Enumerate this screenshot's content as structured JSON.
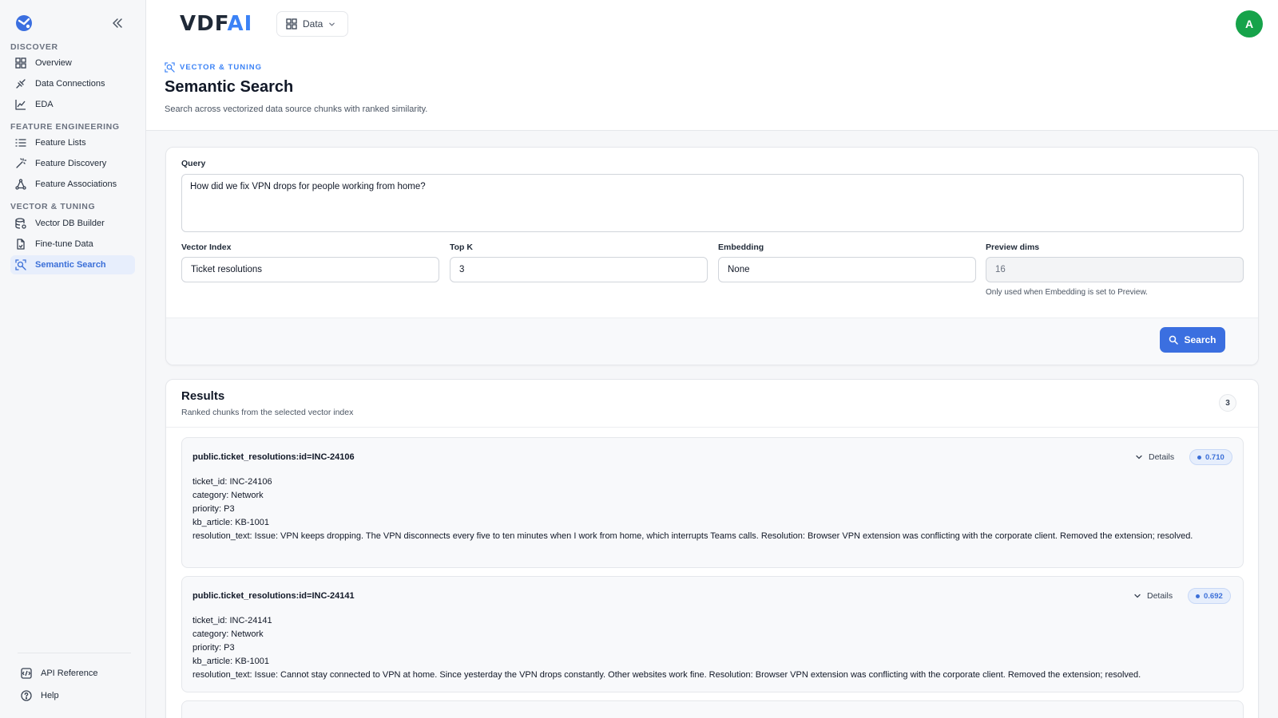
{
  "sidebar": {
    "sections": [
      {
        "title": "DISCOVER",
        "items": [
          {
            "label": "Overview",
            "icon": "grid-icon"
          },
          {
            "label": "Data Connections",
            "icon": "plug-icon"
          },
          {
            "label": "EDA",
            "icon": "chart-icon"
          }
        ]
      },
      {
        "title": "FEATURE ENGINEERING",
        "items": [
          {
            "label": "Feature Lists",
            "icon": "list-icon"
          },
          {
            "label": "Feature Discovery",
            "icon": "wand-icon"
          },
          {
            "label": "Feature Associations",
            "icon": "network-icon"
          }
        ]
      },
      {
        "title": "VECTOR & TUNING",
        "items": [
          {
            "label": "Vector DB Builder",
            "icon": "database-icon"
          },
          {
            "label": "Fine-tune Data",
            "icon": "file-icon"
          },
          {
            "label": "Semantic Search",
            "icon": "search-scan-icon",
            "active": true
          }
        ]
      }
    ],
    "footer": [
      {
        "label": "API Reference",
        "icon": "api-icon"
      },
      {
        "label": "Help",
        "icon": "help-icon"
      }
    ]
  },
  "topbar": {
    "brand_main": "VDF",
    "brand_ai": "AI",
    "workspace_label": "Data",
    "avatar_initial": "A",
    "avatar_color": "#16a34a"
  },
  "page": {
    "breadcrumb": "VECTOR & TUNING",
    "title": "Semantic Search",
    "subtitle": "Search across vectorized data source chunks with ranked similarity."
  },
  "form": {
    "query_label": "Query",
    "query_value": "How did we fix VPN drops for people working from home?",
    "vector_index_label": "Vector Index",
    "vector_index_value": "Ticket resolutions",
    "top_k_label": "Top K",
    "top_k_value": "3",
    "embedding_label": "Embedding",
    "embedding_value": "None",
    "preview_dims_label": "Preview dims",
    "preview_dims_value": "16",
    "preview_dims_hint": "Only used when Embedding is set to Preview.",
    "search_button": "Search"
  },
  "results": {
    "title": "Results",
    "subtitle": "Ranked chunks from the selected vector index",
    "count": "3",
    "details_label": "Details",
    "items": [
      {
        "id": "public.ticket_resolutions:id=INC-24106",
        "score": "0.710",
        "lines": [
          "ticket_id: INC-24106",
          "category: Network",
          "priority: P3",
          "kb_article: KB-1001",
          "resolution_text: Issue: VPN keeps dropping. The VPN disconnects every five to ten minutes when I work from home, which interrupts Teams calls. Resolution: Browser VPN extension was conflicting with the corporate client. Removed the extension; resolved."
        ]
      },
      {
        "id": "public.ticket_resolutions:id=INC-24141",
        "score": "0.692",
        "lines": [
          "ticket_id: INC-24141",
          "category: Network",
          "priority: P3",
          "kb_article: KB-1001",
          "resolution_text: Issue: Cannot stay connected to VPN at home. Since yesterday the VPN drops constantly. Other websites work fine. Resolution: Browser VPN extension was conflicting with the corporate client. Removed the extension; resolved."
        ]
      }
    ]
  }
}
